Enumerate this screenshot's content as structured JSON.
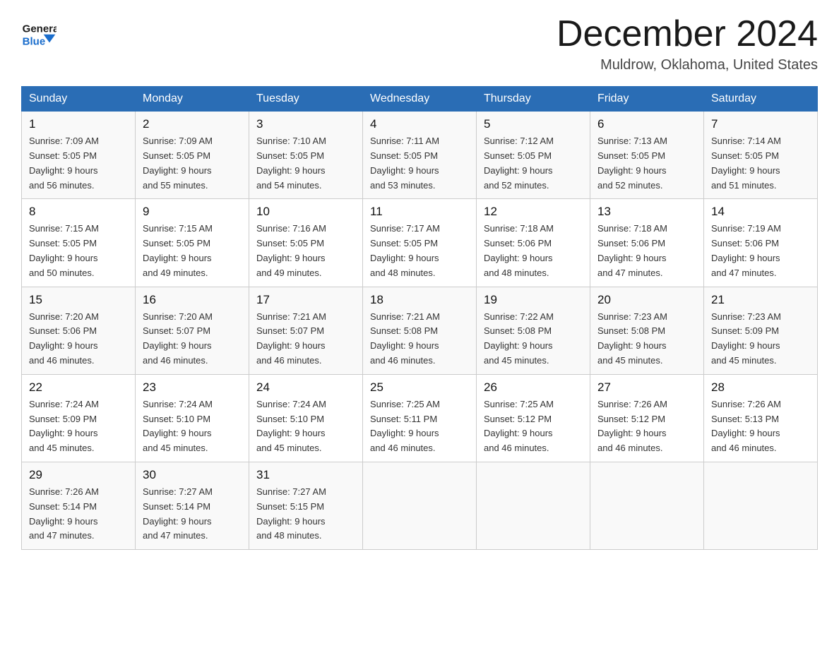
{
  "logo": {
    "line1": "General",
    "arrow": "▶",
    "line2": "Blue"
  },
  "header": {
    "title": "December 2024",
    "subtitle": "Muldrow, Oklahoma, United States"
  },
  "weekdays": [
    "Sunday",
    "Monday",
    "Tuesday",
    "Wednesday",
    "Thursday",
    "Friday",
    "Saturday"
  ],
  "weeks": [
    [
      {
        "day": "1",
        "sunrise": "7:09 AM",
        "sunset": "5:05 PM",
        "daylight": "9 hours and 56 minutes."
      },
      {
        "day": "2",
        "sunrise": "7:09 AM",
        "sunset": "5:05 PM",
        "daylight": "9 hours and 55 minutes."
      },
      {
        "day": "3",
        "sunrise": "7:10 AM",
        "sunset": "5:05 PM",
        "daylight": "9 hours and 54 minutes."
      },
      {
        "day": "4",
        "sunrise": "7:11 AM",
        "sunset": "5:05 PM",
        "daylight": "9 hours and 53 minutes."
      },
      {
        "day": "5",
        "sunrise": "7:12 AM",
        "sunset": "5:05 PM",
        "daylight": "9 hours and 52 minutes."
      },
      {
        "day": "6",
        "sunrise": "7:13 AM",
        "sunset": "5:05 PM",
        "daylight": "9 hours and 52 minutes."
      },
      {
        "day": "7",
        "sunrise": "7:14 AM",
        "sunset": "5:05 PM",
        "daylight": "9 hours and 51 minutes."
      }
    ],
    [
      {
        "day": "8",
        "sunrise": "7:15 AM",
        "sunset": "5:05 PM",
        "daylight": "9 hours and 50 minutes."
      },
      {
        "day": "9",
        "sunrise": "7:15 AM",
        "sunset": "5:05 PM",
        "daylight": "9 hours and 49 minutes."
      },
      {
        "day": "10",
        "sunrise": "7:16 AM",
        "sunset": "5:05 PM",
        "daylight": "9 hours and 49 minutes."
      },
      {
        "day": "11",
        "sunrise": "7:17 AM",
        "sunset": "5:05 PM",
        "daylight": "9 hours and 48 minutes."
      },
      {
        "day": "12",
        "sunrise": "7:18 AM",
        "sunset": "5:06 PM",
        "daylight": "9 hours and 48 minutes."
      },
      {
        "day": "13",
        "sunrise": "7:18 AM",
        "sunset": "5:06 PM",
        "daylight": "9 hours and 47 minutes."
      },
      {
        "day": "14",
        "sunrise": "7:19 AM",
        "sunset": "5:06 PM",
        "daylight": "9 hours and 47 minutes."
      }
    ],
    [
      {
        "day": "15",
        "sunrise": "7:20 AM",
        "sunset": "5:06 PM",
        "daylight": "9 hours and 46 minutes."
      },
      {
        "day": "16",
        "sunrise": "7:20 AM",
        "sunset": "5:07 PM",
        "daylight": "9 hours and 46 minutes."
      },
      {
        "day": "17",
        "sunrise": "7:21 AM",
        "sunset": "5:07 PM",
        "daylight": "9 hours and 46 minutes."
      },
      {
        "day": "18",
        "sunrise": "7:21 AM",
        "sunset": "5:08 PM",
        "daylight": "9 hours and 46 minutes."
      },
      {
        "day": "19",
        "sunrise": "7:22 AM",
        "sunset": "5:08 PM",
        "daylight": "9 hours and 45 minutes."
      },
      {
        "day": "20",
        "sunrise": "7:23 AM",
        "sunset": "5:08 PM",
        "daylight": "9 hours and 45 minutes."
      },
      {
        "day": "21",
        "sunrise": "7:23 AM",
        "sunset": "5:09 PM",
        "daylight": "9 hours and 45 minutes."
      }
    ],
    [
      {
        "day": "22",
        "sunrise": "7:24 AM",
        "sunset": "5:09 PM",
        "daylight": "9 hours and 45 minutes."
      },
      {
        "day": "23",
        "sunrise": "7:24 AM",
        "sunset": "5:10 PM",
        "daylight": "9 hours and 45 minutes."
      },
      {
        "day": "24",
        "sunrise": "7:24 AM",
        "sunset": "5:10 PM",
        "daylight": "9 hours and 45 minutes."
      },
      {
        "day": "25",
        "sunrise": "7:25 AM",
        "sunset": "5:11 PM",
        "daylight": "9 hours and 46 minutes."
      },
      {
        "day": "26",
        "sunrise": "7:25 AM",
        "sunset": "5:12 PM",
        "daylight": "9 hours and 46 minutes."
      },
      {
        "day": "27",
        "sunrise": "7:26 AM",
        "sunset": "5:12 PM",
        "daylight": "9 hours and 46 minutes."
      },
      {
        "day": "28",
        "sunrise": "7:26 AM",
        "sunset": "5:13 PM",
        "daylight": "9 hours and 46 minutes."
      }
    ],
    [
      {
        "day": "29",
        "sunrise": "7:26 AM",
        "sunset": "5:14 PM",
        "daylight": "9 hours and 47 minutes."
      },
      {
        "day": "30",
        "sunrise": "7:27 AM",
        "sunset": "5:14 PM",
        "daylight": "9 hours and 47 minutes."
      },
      {
        "day": "31",
        "sunrise": "7:27 AM",
        "sunset": "5:15 PM",
        "daylight": "9 hours and 48 minutes."
      },
      null,
      null,
      null,
      null
    ]
  ],
  "labels": {
    "sunrise": "Sunrise:",
    "sunset": "Sunset:",
    "daylight": "Daylight:"
  }
}
